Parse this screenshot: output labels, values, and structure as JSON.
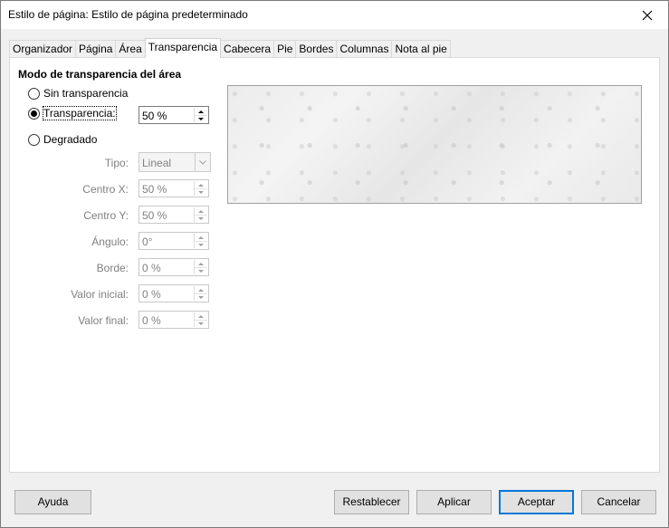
{
  "window": {
    "title": "Estilo de página: Estilo de página predeterminado"
  },
  "tabs": [
    {
      "label": "Organizador"
    },
    {
      "label": "Página"
    },
    {
      "label": "Área"
    },
    {
      "label": "Transparencia",
      "active": true
    },
    {
      "label": "Cabecera"
    },
    {
      "label": "Pie"
    },
    {
      "label": "Bordes"
    },
    {
      "label": "Columnas"
    },
    {
      "label": "Nota al pie"
    }
  ],
  "transparency": {
    "section_title": "Modo de transparencia del área",
    "options": {
      "none": "Sin transparencia",
      "transparency": "Transparencia:",
      "gradient": "Degradado"
    },
    "selected": "transparency",
    "transparency_value": "50 %",
    "gradient": {
      "type_label": "Tipo:",
      "type_value": "Lineal",
      "center_x_label": "Centro X:",
      "center_x_value": "50 %",
      "center_y_label": "Centro Y:",
      "center_y_value": "50 %",
      "angle_label": "Ángulo:",
      "angle_value": "0°",
      "border_label": "Borde:",
      "border_value": "0 %",
      "start_label": "Valor inicial:",
      "start_value": "0 %",
      "end_label": "Valor final:",
      "end_value": "0 %"
    }
  },
  "buttons": {
    "help": "Ayuda",
    "reset": "Restablecer",
    "apply": "Aplicar",
    "ok": "Aceptar",
    "cancel": "Cancelar"
  }
}
